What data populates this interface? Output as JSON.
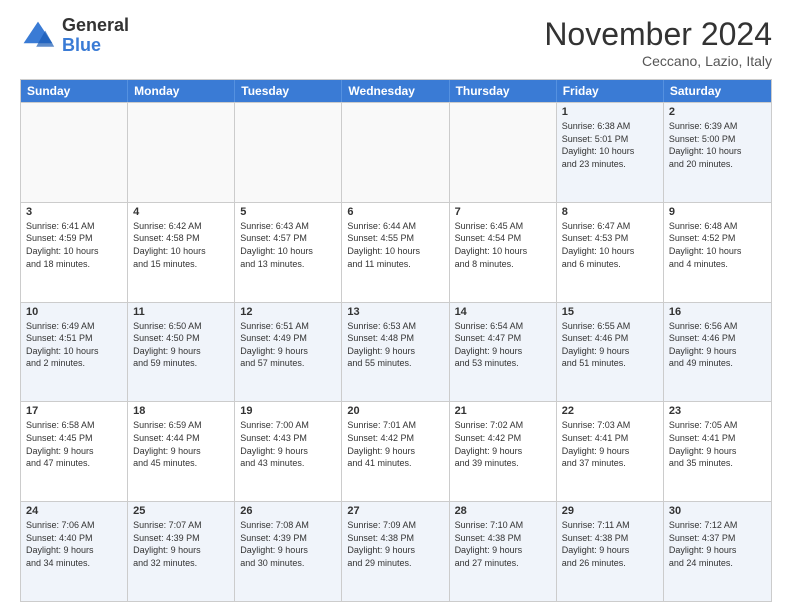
{
  "header": {
    "logo_general": "General",
    "logo_blue": "Blue",
    "month": "November 2024",
    "location": "Ceccano, Lazio, Italy"
  },
  "weekdays": [
    "Sunday",
    "Monday",
    "Tuesday",
    "Wednesday",
    "Thursday",
    "Friday",
    "Saturday"
  ],
  "rows": [
    [
      {
        "day": "",
        "info": "",
        "empty": true
      },
      {
        "day": "",
        "info": "",
        "empty": true
      },
      {
        "day": "",
        "info": "",
        "empty": true
      },
      {
        "day": "",
        "info": "",
        "empty": true
      },
      {
        "day": "",
        "info": "",
        "empty": true
      },
      {
        "day": "1",
        "info": "Sunrise: 6:38 AM\nSunset: 5:01 PM\nDaylight: 10 hours\nand 23 minutes.",
        "empty": false
      },
      {
        "day": "2",
        "info": "Sunrise: 6:39 AM\nSunset: 5:00 PM\nDaylight: 10 hours\nand 20 minutes.",
        "empty": false
      }
    ],
    [
      {
        "day": "3",
        "info": "Sunrise: 6:41 AM\nSunset: 4:59 PM\nDaylight: 10 hours\nand 18 minutes.",
        "empty": false
      },
      {
        "day": "4",
        "info": "Sunrise: 6:42 AM\nSunset: 4:58 PM\nDaylight: 10 hours\nand 15 minutes.",
        "empty": false
      },
      {
        "day": "5",
        "info": "Sunrise: 6:43 AM\nSunset: 4:57 PM\nDaylight: 10 hours\nand 13 minutes.",
        "empty": false
      },
      {
        "day": "6",
        "info": "Sunrise: 6:44 AM\nSunset: 4:55 PM\nDaylight: 10 hours\nand 11 minutes.",
        "empty": false
      },
      {
        "day": "7",
        "info": "Sunrise: 6:45 AM\nSunset: 4:54 PM\nDaylight: 10 hours\nand 8 minutes.",
        "empty": false
      },
      {
        "day": "8",
        "info": "Sunrise: 6:47 AM\nSunset: 4:53 PM\nDaylight: 10 hours\nand 6 minutes.",
        "empty": false
      },
      {
        "day": "9",
        "info": "Sunrise: 6:48 AM\nSunset: 4:52 PM\nDaylight: 10 hours\nand 4 minutes.",
        "empty": false
      }
    ],
    [
      {
        "day": "10",
        "info": "Sunrise: 6:49 AM\nSunset: 4:51 PM\nDaylight: 10 hours\nand 2 minutes.",
        "empty": false
      },
      {
        "day": "11",
        "info": "Sunrise: 6:50 AM\nSunset: 4:50 PM\nDaylight: 9 hours\nand 59 minutes.",
        "empty": false
      },
      {
        "day": "12",
        "info": "Sunrise: 6:51 AM\nSunset: 4:49 PM\nDaylight: 9 hours\nand 57 minutes.",
        "empty": false
      },
      {
        "day": "13",
        "info": "Sunrise: 6:53 AM\nSunset: 4:48 PM\nDaylight: 9 hours\nand 55 minutes.",
        "empty": false
      },
      {
        "day": "14",
        "info": "Sunrise: 6:54 AM\nSunset: 4:47 PM\nDaylight: 9 hours\nand 53 minutes.",
        "empty": false
      },
      {
        "day": "15",
        "info": "Sunrise: 6:55 AM\nSunset: 4:46 PM\nDaylight: 9 hours\nand 51 minutes.",
        "empty": false
      },
      {
        "day": "16",
        "info": "Sunrise: 6:56 AM\nSunset: 4:46 PM\nDaylight: 9 hours\nand 49 minutes.",
        "empty": false
      }
    ],
    [
      {
        "day": "17",
        "info": "Sunrise: 6:58 AM\nSunset: 4:45 PM\nDaylight: 9 hours\nand 47 minutes.",
        "empty": false
      },
      {
        "day": "18",
        "info": "Sunrise: 6:59 AM\nSunset: 4:44 PM\nDaylight: 9 hours\nand 45 minutes.",
        "empty": false
      },
      {
        "day": "19",
        "info": "Sunrise: 7:00 AM\nSunset: 4:43 PM\nDaylight: 9 hours\nand 43 minutes.",
        "empty": false
      },
      {
        "day": "20",
        "info": "Sunrise: 7:01 AM\nSunset: 4:42 PM\nDaylight: 9 hours\nand 41 minutes.",
        "empty": false
      },
      {
        "day": "21",
        "info": "Sunrise: 7:02 AM\nSunset: 4:42 PM\nDaylight: 9 hours\nand 39 minutes.",
        "empty": false
      },
      {
        "day": "22",
        "info": "Sunrise: 7:03 AM\nSunset: 4:41 PM\nDaylight: 9 hours\nand 37 minutes.",
        "empty": false
      },
      {
        "day": "23",
        "info": "Sunrise: 7:05 AM\nSunset: 4:41 PM\nDaylight: 9 hours\nand 35 minutes.",
        "empty": false
      }
    ],
    [
      {
        "day": "24",
        "info": "Sunrise: 7:06 AM\nSunset: 4:40 PM\nDaylight: 9 hours\nand 34 minutes.",
        "empty": false
      },
      {
        "day": "25",
        "info": "Sunrise: 7:07 AM\nSunset: 4:39 PM\nDaylight: 9 hours\nand 32 minutes.",
        "empty": false
      },
      {
        "day": "26",
        "info": "Sunrise: 7:08 AM\nSunset: 4:39 PM\nDaylight: 9 hours\nand 30 minutes.",
        "empty": false
      },
      {
        "day": "27",
        "info": "Sunrise: 7:09 AM\nSunset: 4:38 PM\nDaylight: 9 hours\nand 29 minutes.",
        "empty": false
      },
      {
        "day": "28",
        "info": "Sunrise: 7:10 AM\nSunset: 4:38 PM\nDaylight: 9 hours\nand 27 minutes.",
        "empty": false
      },
      {
        "day": "29",
        "info": "Sunrise: 7:11 AM\nSunset: 4:38 PM\nDaylight: 9 hours\nand 26 minutes.",
        "empty": false
      },
      {
        "day": "30",
        "info": "Sunrise: 7:12 AM\nSunset: 4:37 PM\nDaylight: 9 hours\nand 24 minutes.",
        "empty": false
      }
    ]
  ]
}
